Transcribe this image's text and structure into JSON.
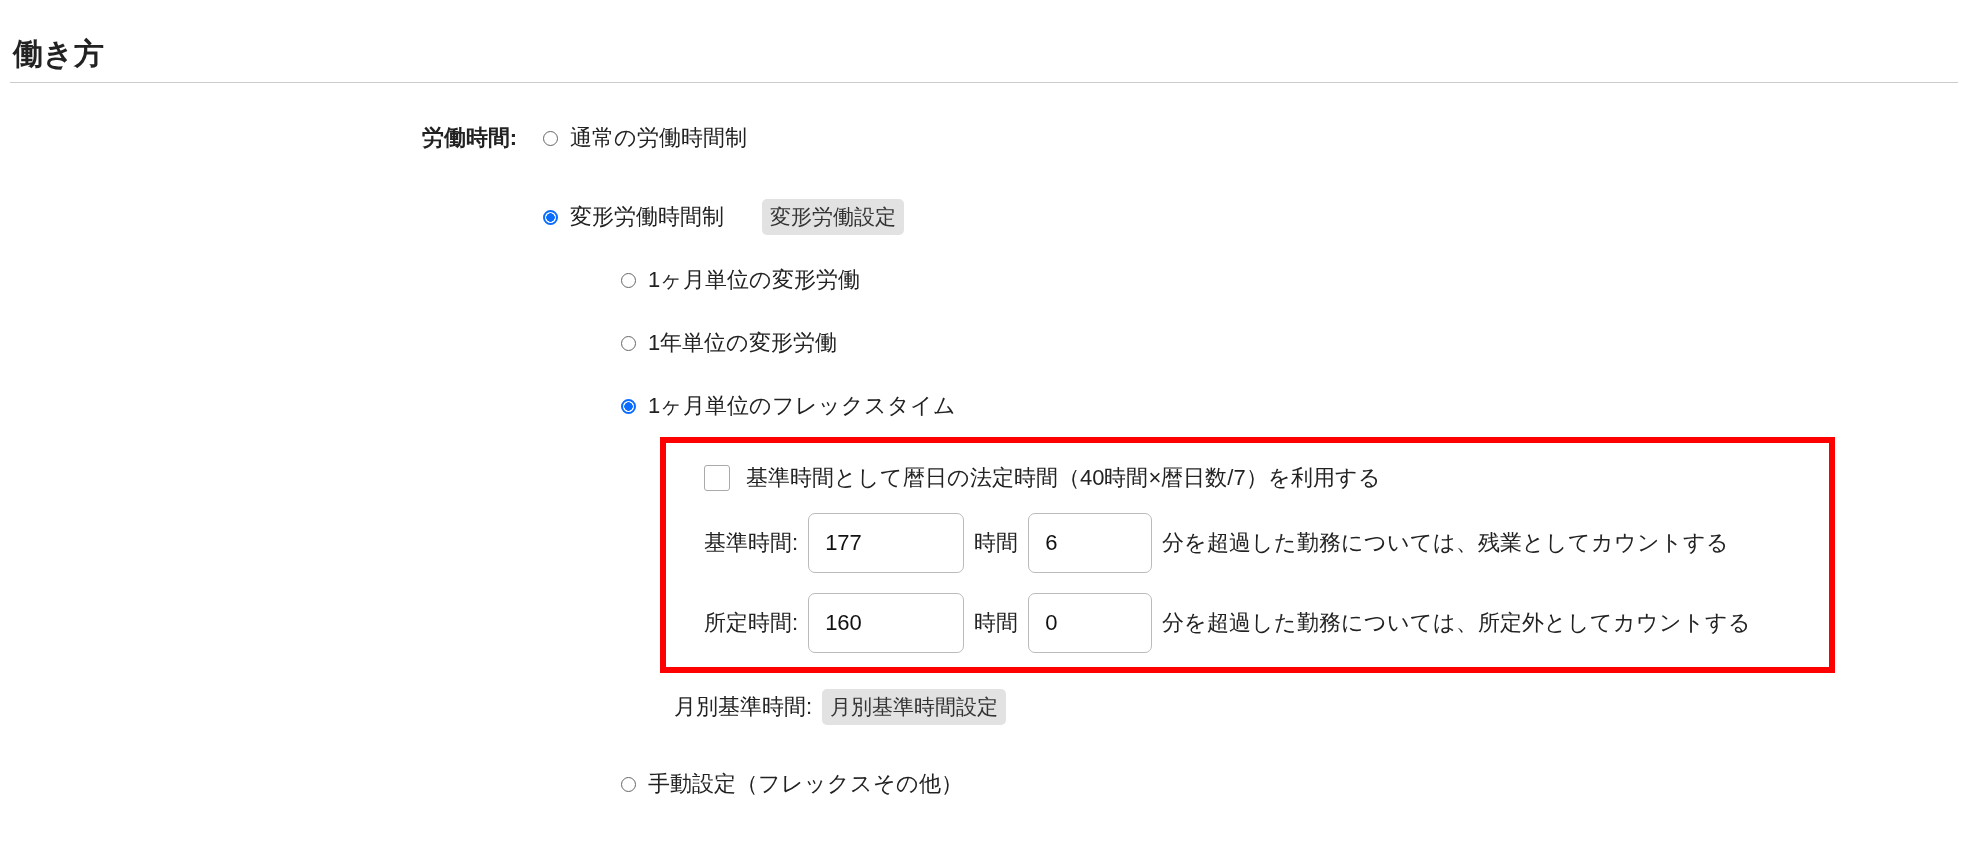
{
  "section_title": "働き方",
  "work_hours": {
    "label": "労働時間:",
    "options": [
      {
        "label": "通常の労働時間制",
        "selected": false
      },
      {
        "label": "変形労働時間制",
        "selected": true,
        "button": "変形労働設定"
      }
    ],
    "sub_options": [
      {
        "label": "1ヶ月単位の変形労働",
        "selected": false
      },
      {
        "label": "1年単位の変形労働",
        "selected": false
      },
      {
        "label": "1ヶ月単位のフレックスタイム",
        "selected": true
      }
    ],
    "flex_settings": {
      "checkbox": {
        "label": "基準時間として暦日の法定時間（40時間×暦日数/7）を利用する",
        "checked": false
      },
      "rows": [
        {
          "label": "基準時間:",
          "hours": "177",
          "hours_unit": "時間",
          "minutes": "6",
          "note": "分を超過した勤務については、残業としてカウントする"
        },
        {
          "label": "所定時間:",
          "hours": "160",
          "hours_unit": "時間",
          "minutes": "0",
          "note": "分を超過した勤務については、所定外としてカウントする"
        }
      ]
    },
    "monthly": {
      "label": "月別基準時間:",
      "button": "月別基準時間設定"
    },
    "manual_option": {
      "label": "手動設定（フレックスその他）",
      "selected": false
    }
  }
}
